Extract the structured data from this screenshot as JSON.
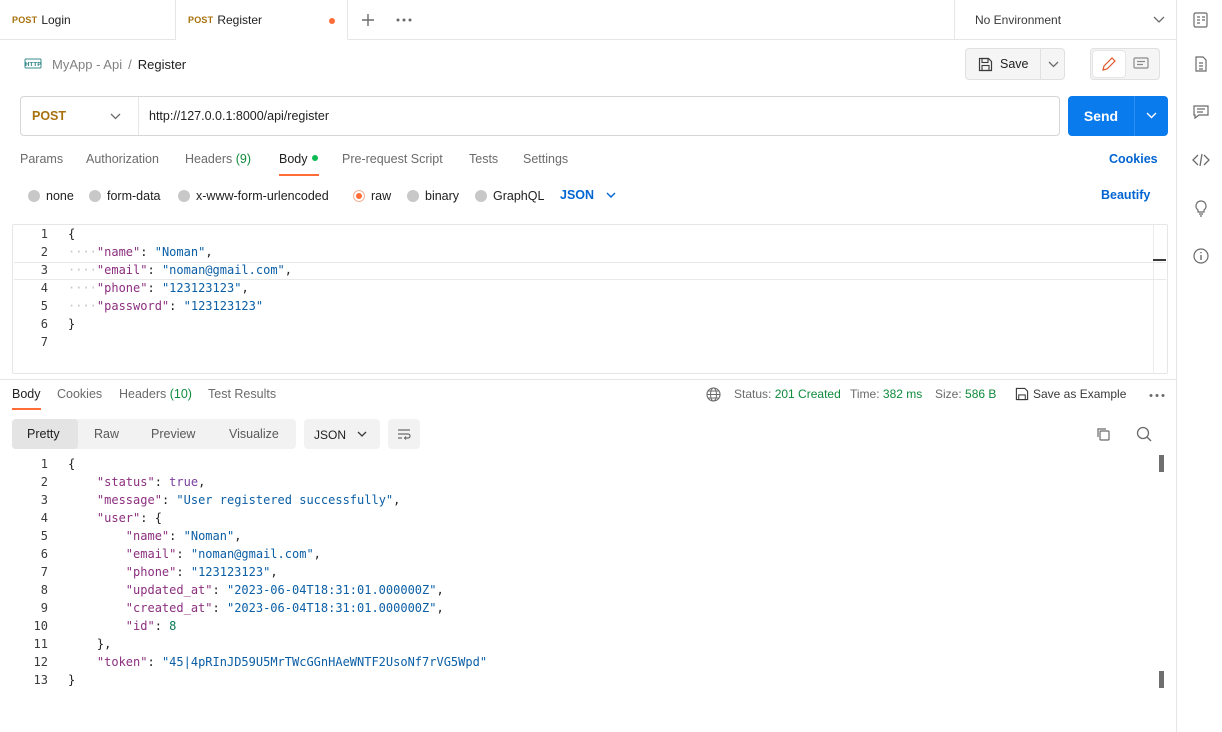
{
  "tabs": [
    {
      "method": "POST",
      "name": "Login"
    },
    {
      "method": "POST",
      "name": "Register",
      "unsaved": true
    }
  ],
  "environment": "No Environment",
  "breadcrumb": {
    "collection": "MyApp - Api",
    "separator": "/",
    "request": "Register"
  },
  "toolbar": {
    "save_label": "Save"
  },
  "request": {
    "method": "POST",
    "url": "http://127.0.0.1:8000/api/register",
    "send_label": "Send"
  },
  "request_tabs": [
    {
      "label": "Params"
    },
    {
      "label": "Authorization"
    },
    {
      "label": "Headers",
      "count": "(9)"
    },
    {
      "label": "Body"
    },
    {
      "label": "Pre-request Script"
    },
    {
      "label": "Tests"
    },
    {
      "label": "Settings"
    }
  ],
  "cookies_link": "Cookies",
  "body_types": [
    "none",
    "form-data",
    "x-www-form-urlencoded",
    "raw",
    "binary",
    "GraphQL"
  ],
  "body_format": "JSON",
  "beautify_link": "Beautify",
  "request_body_lines": [
    "1",
    "2",
    "3",
    "4",
    "5",
    "6",
    "7"
  ],
  "request_body": {
    "name": "Noman",
    "email": "noman@gmail.com",
    "phone": "123123123",
    "password": "123123123"
  },
  "response_tabs": [
    {
      "label": "Body"
    },
    {
      "label": "Cookies"
    },
    {
      "label": "Headers",
      "count": "(10)"
    },
    {
      "label": "Test Results"
    }
  ],
  "response_meta": {
    "status_label": "Status:",
    "status": "201 Created",
    "time_label": "Time:",
    "time": "382 ms",
    "size_label": "Size:",
    "size": "586 B",
    "save_example": "Save as Example"
  },
  "view_modes": [
    "Pretty",
    "Raw",
    "Preview",
    "Visualize"
  ],
  "response_format": "JSON",
  "response_body_lines": [
    "1",
    "2",
    "3",
    "4",
    "5",
    "6",
    "7",
    "8",
    "9",
    "10",
    "11",
    "12",
    "13"
  ],
  "response_body": {
    "status": "true",
    "message": "User registered successfully",
    "user": {
      "name": "Noman",
      "email": "noman@gmail.com",
      "phone": "123123123",
      "updated_at": "2023-06-04T18:31:01.000000Z",
      "created_at": "2023-06-04T18:31:01.000000Z",
      "id": "8"
    },
    "token": "45|4pRInJD59U5MrTWcGGnHAeWNTF2UsoNf7rVG5Wpd"
  },
  "colors": {
    "accent": "#ff6c37",
    "send": "#097bed",
    "method": "#a8710d",
    "link": "#0265d2",
    "success": "#0f8a3c"
  }
}
